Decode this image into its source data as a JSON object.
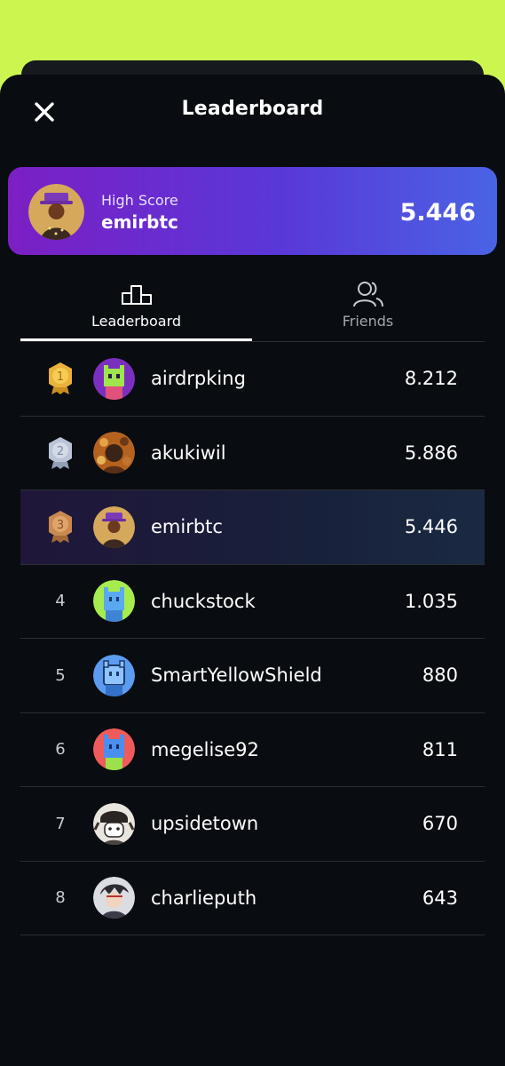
{
  "header": {
    "title": "Leaderboard",
    "close_icon": "close-icon"
  },
  "high_score": {
    "label": "High Score",
    "username": "emirbtc",
    "score": "5.446"
  },
  "tabs": [
    {
      "label": "Leaderboard",
      "icon": "podium-icon",
      "active": true
    },
    {
      "label": "Friends",
      "icon": "friends-icon",
      "active": false
    }
  ],
  "rows": [
    {
      "rank": "1",
      "medal": "gold",
      "username": "airdrpking",
      "score": "8.212"
    },
    {
      "rank": "2",
      "medal": "silver",
      "username": "akukiwil",
      "score": "5.886"
    },
    {
      "rank": "3",
      "medal": "bronze",
      "username": "emirbtc",
      "score": "5.446"
    },
    {
      "rank": "4",
      "username": "chuckstock",
      "score": "1.035"
    },
    {
      "rank": "5",
      "username": "SmartYellowShield",
      "score": "880"
    },
    {
      "rank": "6",
      "username": "megelise92",
      "score": "811"
    },
    {
      "rank": "7",
      "username": "upsidetown",
      "score": "670"
    },
    {
      "rank": "8",
      "username": "charlieputh",
      "score": "643"
    }
  ],
  "colors": {
    "background": "#ccf550",
    "sheet": "#090c10",
    "gradient_start": "#7b1fc4",
    "gradient_end": "#4a63e4",
    "gold": "#e9b23a",
    "silver": "#b9c4d6",
    "bronze": "#c98a50"
  }
}
